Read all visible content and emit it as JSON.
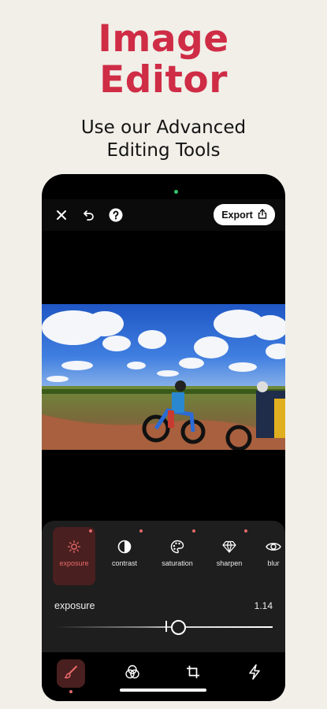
{
  "hero": {
    "title_line1": "Image",
    "title_line2": "Editor",
    "subtitle_line1": "Use our Advanced",
    "subtitle_line2": "Editing Tools"
  },
  "topbar": {
    "icons": [
      "close-icon",
      "undo-icon",
      "help-icon"
    ],
    "export_label": "Export",
    "export_icon": "share-icon"
  },
  "tools": [
    {
      "label": "exposure",
      "icon": "sun-icon",
      "active": true,
      "changed": true
    },
    {
      "label": "contrast",
      "icon": "contrast-icon",
      "active": false,
      "changed": true
    },
    {
      "label": "saturation",
      "icon": "palette-icon",
      "active": false,
      "changed": true
    },
    {
      "label": "sharpen",
      "icon": "diamond-icon",
      "active": false,
      "changed": true
    },
    {
      "label": "blur",
      "icon": "eye-icon",
      "active": false,
      "changed": false
    }
  ],
  "adjustment": {
    "label": "exposure",
    "value": "1.14",
    "slider_fraction": 0.57
  },
  "bottom_nav": [
    {
      "icon": "brush-icon",
      "active": true
    },
    {
      "icon": "filters-icon",
      "active": false
    },
    {
      "icon": "crop-icon",
      "active": false
    },
    {
      "icon": "flash-icon",
      "active": false
    }
  ],
  "colors": {
    "accent": "#cf2c46",
    "background": "#f1efe8",
    "active_tool_bg": "#4a1f1f",
    "active_label": "#e86a6a"
  }
}
